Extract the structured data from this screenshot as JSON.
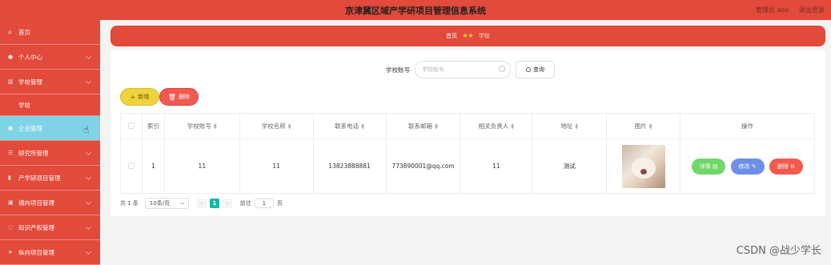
{
  "header": {
    "title": "京津冀区域产学研项目管理信息系统",
    "user_label": "管理员 abo",
    "logout_label": "退出登录"
  },
  "sidebar": {
    "items": [
      {
        "label": "首页",
        "icon": "home-icon",
        "sub": false,
        "active": false,
        "chevron": false
      },
      {
        "label": "个人中心",
        "icon": "user-icon",
        "sub": false,
        "active": false,
        "chevron": true
      },
      {
        "label": "学校管理",
        "icon": "bank-icon",
        "sub": false,
        "active": false,
        "chevron": true
      },
      {
        "label": "学校",
        "icon": "",
        "sub": true,
        "active": false,
        "chevron": false
      },
      {
        "label": "企业管理",
        "icon": "user-icon",
        "sub": false,
        "active": true,
        "chevron": true
      },
      {
        "label": "研究所管理",
        "icon": "list-icon",
        "sub": false,
        "active": false,
        "chevron": true
      },
      {
        "label": "产学研项目管理",
        "icon": "chart-icon",
        "sub": false,
        "active": false,
        "chevron": true
      },
      {
        "label": "横向项目管理",
        "icon": "image-icon",
        "sub": false,
        "active": false,
        "chevron": true
      },
      {
        "label": "知识产权管理",
        "icon": "circle-icon",
        "sub": false,
        "active": false,
        "chevron": true
      },
      {
        "label": "纵向项目管理",
        "icon": "send-icon",
        "sub": false,
        "active": false,
        "chevron": true
      }
    ]
  },
  "breadcrumb": {
    "home": "首页",
    "current": "学校"
  },
  "search": {
    "label": "学校账号",
    "placeholder": "学校账号",
    "button_label": "查询"
  },
  "actions": {
    "add_label": "新增",
    "delete_label": "删除"
  },
  "table": {
    "headers": [
      "索引",
      "学校账号",
      "学校名称",
      "联系电话",
      "联系邮箱",
      "相关负责人",
      "地址",
      "图片",
      "操作"
    ],
    "rows": [
      {
        "index": "1",
        "account": "11",
        "name": "11",
        "phone": "13823888881",
        "email": "773890001@qq.com",
        "owner": "11",
        "address": "测试",
        "detail": "详情",
        "edit": "修改",
        "remove": "删除"
      }
    ]
  },
  "pager": {
    "total": "共 1 条",
    "page_size": "10条/页",
    "current_page": "1",
    "goto_label": "前往",
    "goto_value": "1",
    "page_suffix": "页"
  },
  "watermark": "CSDN @战少学长",
  "colors": {
    "primary_red": "#e24a3b",
    "active_cyan": "#7ed4e6",
    "add_yellow": "#eed33c",
    "danger_red": "#f15a4f",
    "detail_green": "#6fd76a",
    "edit_blue": "#6f8ee8",
    "pager_teal": "#14b8a6"
  }
}
